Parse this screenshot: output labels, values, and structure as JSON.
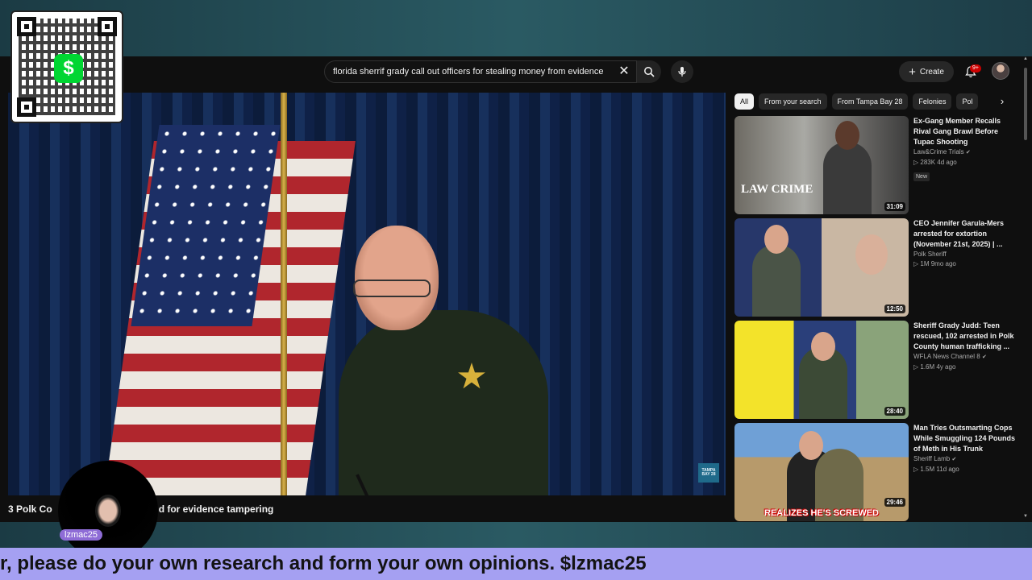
{
  "search": {
    "query": "florida sherrif grady call out officers for stealing money from evidence",
    "clear_icon": "close-icon",
    "search_icon": "search-icon",
    "mic_icon": "mic-icon"
  },
  "header": {
    "create_label": "Create",
    "notifications_badge": "9+"
  },
  "player": {
    "title_visible_start": "3 Polk Co",
    "title_visible_end": "d for evidence tampering",
    "watermark": "TAMPA BAY 28"
  },
  "chips": [
    "All",
    "From your search",
    "From Tampa Bay 28",
    "Felonies",
    "Pol"
  ],
  "recommendations": [
    {
      "title": "Ex-Gang Member Recalls Rival Gang Brawl Before Tupac Shooting",
      "channel": "Law&Crime Trials",
      "verified": true,
      "stats": "▷ 283K  4d ago",
      "badge": "New",
      "duration": "31:09",
      "overlay_text": "LAW CRIME"
    },
    {
      "title": "CEO Jennifer Garula-Mers arrested for extortion (November 21st, 2025) | ...",
      "channel": "Polk Sheriff",
      "verified": false,
      "stats": "▷ 1M  9mo ago",
      "duration": "12:50"
    },
    {
      "title": "Sheriff Grady Judd: Teen rescued, 102 arrested in Polk County human trafficking ...",
      "channel": "WFLA News Channel 8",
      "verified": true,
      "stats": "▷ 1.6M  4y ago",
      "duration": "28:40"
    },
    {
      "title": "Man Tries Outsmarting Cops While Smuggling 124 Pounds of Meth in His Trunk",
      "channel": "Sheriff Lamb",
      "verified": true,
      "stats": "▷ 1.5M  11d ago",
      "duration": "29:46",
      "overlay_text": "REALIZES HE'S SCREWED"
    }
  ],
  "overlays": {
    "cashapp_symbol": "$",
    "streamer_tag": "lzmac25",
    "ticker": "r, please do your own research and form your own opinions. $lzmac25"
  },
  "colors": {
    "youtube_bg": "#0f0f0f",
    "cashapp_green": "#00d632",
    "ticker_bg": "#a5a0f2",
    "streamer_tag_bg": "#8e6cd6"
  }
}
